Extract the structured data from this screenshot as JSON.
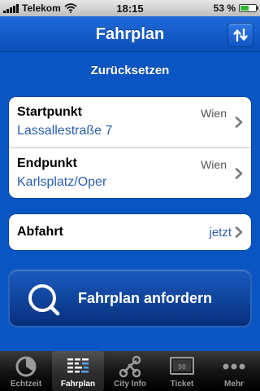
{
  "status_bar": {
    "carrier": "Telekom",
    "time": "18:15",
    "battery": "53 %",
    "battery_level": 0.53
  },
  "nav": {
    "title": "Fahrplan",
    "swap_icon": "swap-vertical-arrows-icon"
  },
  "reset_label": "Zurücksetzen",
  "route": {
    "start": {
      "label": "Startpunkt",
      "city": "Wien",
      "value": "Lassallestraße 7"
    },
    "end": {
      "label": "Endpunkt",
      "city": "Wien",
      "value": "Karlsplatz/Oper"
    }
  },
  "departure": {
    "label": "Abfahrt",
    "value": "jetzt"
  },
  "request_button": {
    "label": "Fahrplan anfordern",
    "icon": "search-magnifier-icon"
  },
  "tabs": [
    {
      "label": "Echtzeit",
      "icon": "clock-icon",
      "active": false
    },
    {
      "label": "Fahrplan",
      "icon": "timetable-icon",
      "active": true
    },
    {
      "label": "City Info",
      "icon": "network-nodes-icon",
      "active": false
    },
    {
      "label": "Ticket",
      "icon": "ticket-icon",
      "active": false
    },
    {
      "label": "Mehr",
      "icon": "more-dots-icon",
      "active": false
    }
  ],
  "colors": {
    "background": "#0a55c4",
    "link_blue": "#2a5fad",
    "tab_active": "#ffffff",
    "tab_inactive": "#9a9a9a"
  }
}
